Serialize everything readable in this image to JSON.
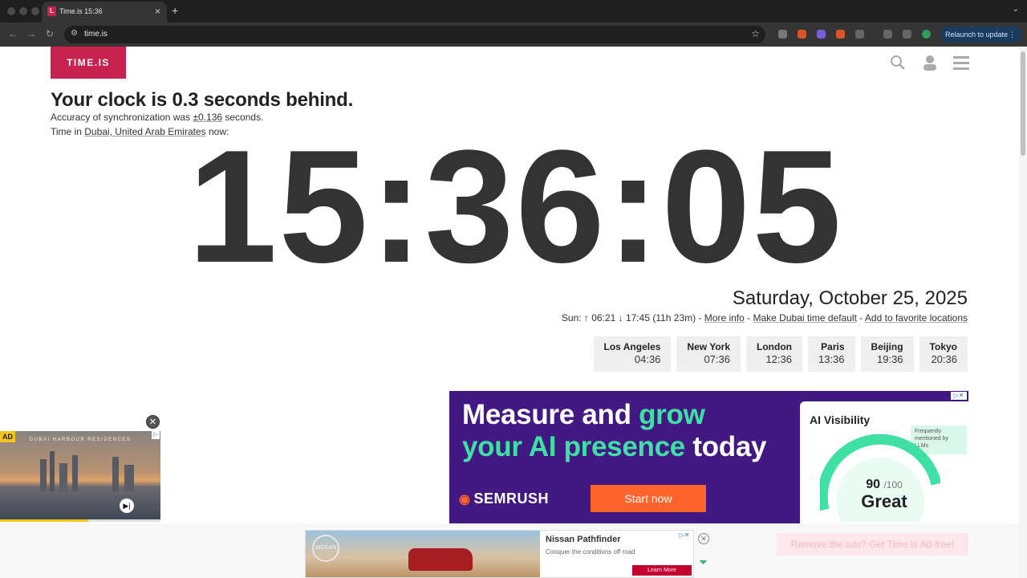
{
  "browser": {
    "tab_title": "Time.is 15:36",
    "tab_favicon": "L",
    "url": "time.is",
    "relaunch_label": "Relaunch to update"
  },
  "site": {
    "logo": "TIME.IS",
    "headline": "Your clock is 0.3 seconds behind.",
    "accuracy_prefix": "Accuracy of synchronization was ",
    "accuracy_value": "±0.136",
    "accuracy_suffix": " seconds.",
    "location_prefix": "Time in ",
    "location_link": "Dubai, United Arab Emirates",
    "location_suffix": " now:",
    "clock": "15:36:05",
    "date": "Saturday, October 25, 2025",
    "sun_info": "Sun: ↑ 06:21 ↓ 17:45 (11h 23m) - ",
    "more_info": "More info",
    "sep1": " - ",
    "make_default": "Make Dubai time default",
    "sep2": " - ",
    "add_favorite": "Add to favorite locations",
    "cities": [
      {
        "name": "Los Angeles",
        "time": "04:36"
      },
      {
        "name": "New York",
        "time": "07:36"
      },
      {
        "name": "London",
        "time": "12:36"
      },
      {
        "name": "Paris",
        "time": "13:36"
      },
      {
        "name": "Beijing",
        "time": "19:36"
      },
      {
        "name": "Tokyo",
        "time": "20:36"
      }
    ]
  },
  "ads": {
    "semrush": {
      "line1_a": "Measure and ",
      "line1_b": "grow",
      "line2_a": "your AI presence",
      "line2_b": " today",
      "brand": "SEMRUSH",
      "cta": "Start now",
      "panel_title": "AI Visibility",
      "panel_note": "Frequently mentioned by LLMs",
      "score": "90",
      "score_of": "/100",
      "grade": "Great"
    },
    "video": {
      "tag": "AD",
      "title": "DUBAI HARBOUR RESIDENCES",
      "progress": 0.55
    },
    "nissan": {
      "logo": "NISSAN",
      "title": "Nissan Pathfinder",
      "subtitle": "Conquer the conditions off road",
      "cta": "Learn More"
    },
    "remove_ads": "Remove the ads? Get Time.is Ad-free!"
  },
  "colors": {
    "brand": "#c8234f",
    "semrush_bg": "#421983",
    "semrush_green": "#3ee0a4",
    "semrush_orange": "#ff642d"
  }
}
